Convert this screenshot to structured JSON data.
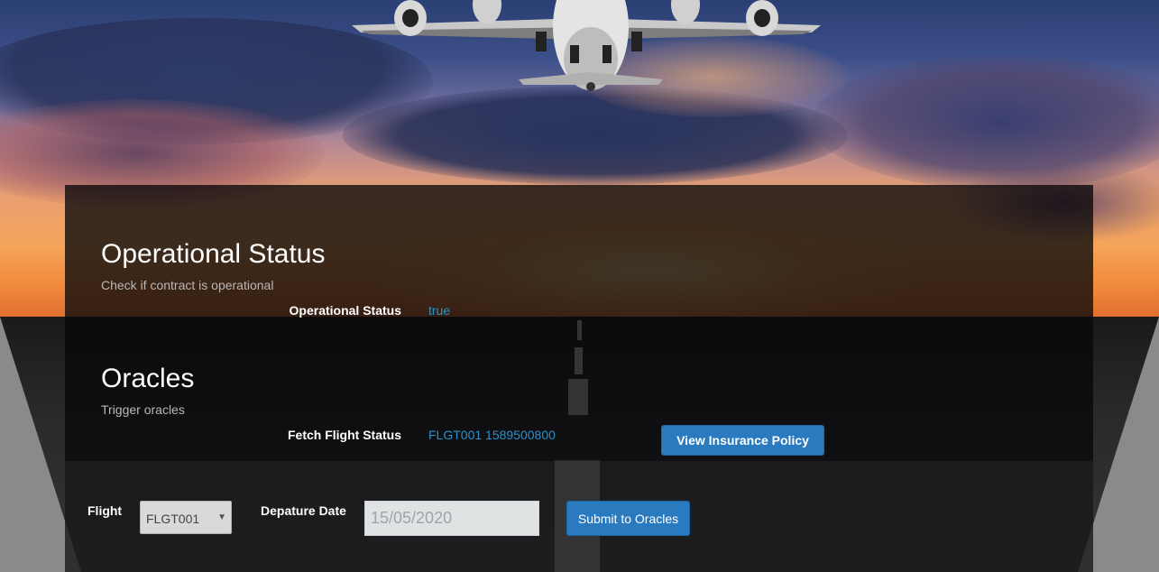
{
  "operational": {
    "title": "Operational Status",
    "subtitle": "Check if contract is operational",
    "status_label": "Operational Status",
    "status_value": "true"
  },
  "oracles": {
    "title": "Oracles",
    "subtitle": "Trigger oracles",
    "fetch_label": "Fetch Flight Status",
    "fetch_value": "FLGT001 1589500800",
    "view_policy_button": "View Insurance Policy"
  },
  "form": {
    "flight_label": "Flight",
    "flight_selected": "FLGT001",
    "date_label": "Depature Date",
    "date_value": "15/05/2020",
    "submit_button": "Submit to Oracles"
  },
  "colors": {
    "accent_link": "#2a92c9",
    "button": "#2a7ac0"
  }
}
